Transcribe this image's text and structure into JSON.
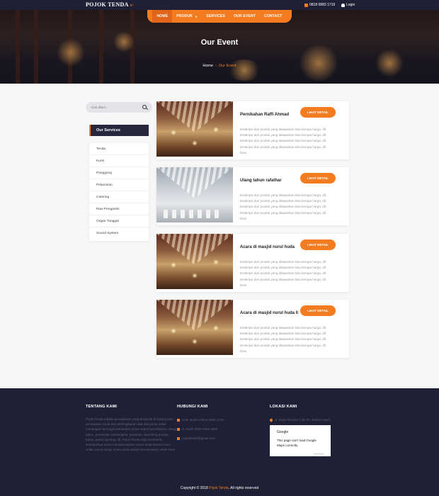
{
  "topbar": {
    "brand": "POJOK TENDA",
    "brand_tag": "87",
    "phone": "0818 0883 1719",
    "login": "Login"
  },
  "nav": {
    "items": [
      {
        "label": "HOME",
        "active": true
      },
      {
        "label": "PRODUK",
        "dropdown": true
      },
      {
        "label": "SERVICES"
      },
      {
        "label": "OUR EVENT"
      },
      {
        "label": "CONTACT"
      }
    ]
  },
  "hero": {
    "title": "Our Event",
    "breadcrumb_home": "Home",
    "breadcrumb_current": "Our Event"
  },
  "sidebar": {
    "search_placeholder": "Cari disini...",
    "services_heading": "Our Services",
    "items": [
      "Tenda",
      "Kursi",
      "Panggung",
      "Pelaminan",
      "Catering",
      "Rias Pengantin",
      "Organ Tunggal",
      "Sound System"
    ]
  },
  "events": [
    {
      "title": "Pernikahan Raffi Ahmad",
      "button": "LIHAT DETAIL",
      "description": "Deskripsi dari produk yang ditawarkan bisa berupa harga, dll. Deskripsi dari produk yang ditawarkan bisa berupa harga, dll. Deskripsi dari produk yang ditawarkan bisa berupa harga, dll. Deskripsi dari produk yang ditawarkan bisa berupa harga, dll. Desi"
    },
    {
      "title": "Ulang tahun rafathar",
      "button": "LIHAT DETAIL",
      "description": "Deskripsi dari produk yang ditawarkan bisa berupa harga, dll. Deskripsi dari produk yang ditawarkan bisa berupa harga, dll. Deskripsi dari produk yang ditawarkan bisa berupa harga, dll. Deskripsi dari produk yang ditawarkan bisa berupa harga, dll. Desi"
    },
    {
      "title": "Acara di masjid nurul huda",
      "button": "LIHAT DETAIL",
      "description": "Deskripsi dari produk yang ditawarkan bisa berupa harga, dll. Deskripsi dari produk yang ditawarkan bisa berupa harga, dll. Deskripsi dari produk yang ditawarkan bisa berupa harga, dll. Deskripsi dari produk yang ditawarkan bisa berupa harga, dll. Desi"
    },
    {
      "title": "Acara di masjid nurul huda II",
      "button": "LIHAT DETAIL",
      "description": "Deskripsi dari produk yang ditawarkan bisa berupa harga, dll. Deskripsi dari produk yang ditawarkan bisa berupa harga, dll. Deskripsi dari produk yang ditawarkan bisa berupa harga, dll. Deskripsi dari produk yang ditawarkan bisa berupa harga, dll. Desi"
    }
  ],
  "footer": {
    "about_heading": "TENTANG KAMI",
    "about_text": "Pojok Tenda adalah perusahaan yang bergerak di bidang jasa persewaan tenda dan perlengkapan alat-alat pesta untuk menangani berbagai kebutuhan acara seperti pernikahan, ulang tahun, peresmian kantor/jalan, pameran, launching produk, bazar, grand opening, dll. Pojok Tenda siap membantu terwujudnya acara mempersiapkan acara anda karena kami selalu prima setiap acara anda adalah kenyamanan untuk kami.",
    "contact_heading": "HUBUNGI KAMI",
    "contact_1": "H.M. Muslim 0818 0883 1719",
    "contact_2": "H. Oyeh 0818 0863 6590",
    "email": "pojoktenda@gmail.com",
    "location_heading": "LOKASI KAMI",
    "address": "Jl. Kuari Perwira 1 No 57, Bekasi Utara",
    "map_brand": "Google",
    "map_message": "This page can't load Google Maps correctly.",
    "copyright_prefix": "Copyright © 2018",
    "copyright_brand": "Pojok Tenda",
    "copyright_suffix": ". All rights reserved"
  },
  "colors": {
    "accent": "#f47c20",
    "navy": "#1f2036"
  }
}
